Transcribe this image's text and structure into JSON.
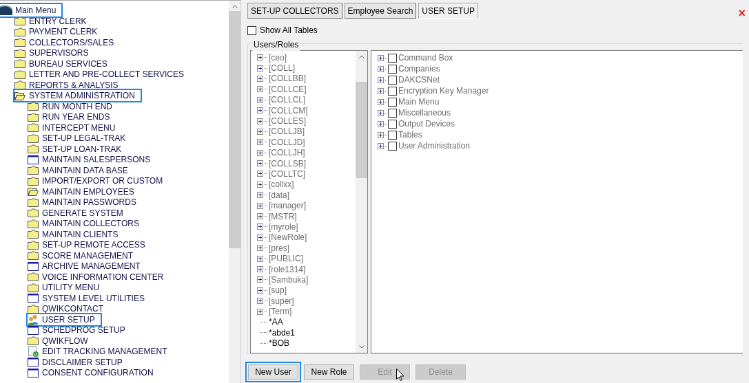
{
  "menu": {
    "label": "Main Menu",
    "highlighted": true,
    "children": [
      {
        "label": "ENTRY CLERK",
        "kind": "folder",
        "highlighted": false
      },
      {
        "label": "PAYMENT CLERK",
        "kind": "folder",
        "highlighted": false
      },
      {
        "label": "COLLECTORS/SALES",
        "kind": "folder",
        "highlighted": false
      },
      {
        "label": "SUPERVISORS",
        "kind": "folder",
        "highlighted": false
      },
      {
        "label": "BUREAU SERVICES",
        "kind": "folder",
        "highlighted": false
      },
      {
        "label": "LETTER AND PRE-COLLECT SERVICES",
        "kind": "folder",
        "highlighted": false
      },
      {
        "label": "REPORTS & ANALYSIS",
        "kind": "folder",
        "highlighted": false
      },
      {
        "label": "SYSTEM ADMINISTRATION",
        "kind": "folder-open",
        "highlighted": true,
        "children": [
          {
            "label": "RUN MONTH END",
            "kind": "folder",
            "highlighted": false
          },
          {
            "label": "RUN YEAR ENDS",
            "kind": "folder",
            "highlighted": false
          },
          {
            "label": "INTERCEPT MENU",
            "kind": "folder",
            "highlighted": false
          },
          {
            "label": "SET-UP LEGAL-TRAK",
            "kind": "folder",
            "highlighted": false
          },
          {
            "label": "SET-UP LOAN-TRAK",
            "kind": "folder",
            "highlighted": false
          },
          {
            "label": "MAINTAIN SALESPERSONS",
            "kind": "window",
            "highlighted": false
          },
          {
            "label": "MAINTAIN DATA BASE",
            "kind": "folder",
            "highlighted": false
          },
          {
            "label": "IMPORT/EXPORT OR CUSTOM",
            "kind": "folder",
            "highlighted": false
          },
          {
            "label": "MAINTAIN EMPLOYEES",
            "kind": "folder-open",
            "highlighted": false
          },
          {
            "label": "MAINTAIN PASSWORDS",
            "kind": "folder",
            "highlighted": false
          },
          {
            "label": "GENERATE SYSTEM",
            "kind": "folder",
            "highlighted": false
          },
          {
            "label": "MAINTAIN COLLECTORS",
            "kind": "folder",
            "highlighted": false
          },
          {
            "label": "MAINTAIN CLIENTS",
            "kind": "folder",
            "highlighted": false
          },
          {
            "label": "SET-UP REMOTE ACCESS",
            "kind": "folder",
            "highlighted": false
          },
          {
            "label": "SCORE MANAGEMENT",
            "kind": "folder",
            "highlighted": false
          },
          {
            "label": "ARCHIVE MANAGEMENT",
            "kind": "window",
            "highlighted": false
          },
          {
            "label": "VOICE INFORMATION CENTER",
            "kind": "folder",
            "highlighted": false
          },
          {
            "label": "UTILITY MENU",
            "kind": "folder",
            "highlighted": false
          },
          {
            "label": "SYSTEM LEVEL UTILITIES",
            "kind": "window",
            "highlighted": false
          },
          {
            "label": "QWIKCONTACT",
            "kind": "folder",
            "highlighted": false
          },
          {
            "label": "USER SETUP",
            "kind": "users",
            "highlighted": true
          },
          {
            "label": "SCHEDPROG SETUP",
            "kind": "window",
            "highlighted": false
          },
          {
            "label": "QWIKFLOW",
            "kind": "folder",
            "highlighted": false
          },
          {
            "label": "EDIT TRACKING MANAGEMENT",
            "kind": "doc-check",
            "highlighted": false
          },
          {
            "label": "DISCLAIMER SETUP",
            "kind": "window",
            "highlighted": false
          },
          {
            "label": "CONSENT CONFIGURATION",
            "kind": "window",
            "highlighted": false
          }
        ]
      }
    ]
  },
  "tabs": [
    {
      "label": "SET-UP COLLECTORS",
      "selected": false
    },
    {
      "label": "Employee Search",
      "selected": false
    },
    {
      "label": "USER SETUP",
      "selected": true
    }
  ],
  "close": "×",
  "show_all_tables": {
    "label": "Show All Tables",
    "checked": false
  },
  "group_title": "Users/Roles",
  "users_roles": [
    {
      "label": "[ceo]",
      "kind": "role"
    },
    {
      "label": "[COLL]",
      "kind": "role"
    },
    {
      "label": "[COLLBB]",
      "kind": "role"
    },
    {
      "label": "[COLLCE]",
      "kind": "role"
    },
    {
      "label": "[COLLCL]",
      "kind": "role"
    },
    {
      "label": "[COLLCM]",
      "kind": "role"
    },
    {
      "label": "[COLLES]",
      "kind": "role"
    },
    {
      "label": "[COLLJB]",
      "kind": "role"
    },
    {
      "label": "[COLLJD]",
      "kind": "role"
    },
    {
      "label": "[COLLJH]",
      "kind": "role"
    },
    {
      "label": "[COLLSB]",
      "kind": "role"
    },
    {
      "label": "[COLLTC]",
      "kind": "role"
    },
    {
      "label": "[collxx]",
      "kind": "role"
    },
    {
      "label": "[data]",
      "kind": "role"
    },
    {
      "label": "[manager]",
      "kind": "role"
    },
    {
      "label": "[MSTR]",
      "kind": "role"
    },
    {
      "label": "[myrole]",
      "kind": "role"
    },
    {
      "label": "[NewRole]",
      "kind": "role"
    },
    {
      "label": "[pres]",
      "kind": "role"
    },
    {
      "label": "[PUBLIC]",
      "kind": "role"
    },
    {
      "label": "[role1314]",
      "kind": "role"
    },
    {
      "label": "[Sambuka]",
      "kind": "role"
    },
    {
      "label": "[sup]",
      "kind": "role"
    },
    {
      "label": "[super]",
      "kind": "role"
    },
    {
      "label": "[Term]",
      "kind": "role"
    },
    {
      "label": "*AA",
      "kind": "user"
    },
    {
      "label": "*abde1",
      "kind": "user"
    },
    {
      "label": "*BOB",
      "kind": "user"
    }
  ],
  "permissions": [
    {
      "label": "Command Box",
      "checked": false
    },
    {
      "label": "Companies",
      "checked": false
    },
    {
      "label": "DAKCSNet",
      "checked": false
    },
    {
      "label": "Encryption Key Manager",
      "checked": false
    },
    {
      "label": "Main Menu",
      "checked": false
    },
    {
      "label": "Miscellaneous",
      "checked": false
    },
    {
      "label": "Output Devices",
      "checked": false
    },
    {
      "label": "Tables",
      "checked": false
    },
    {
      "label": "User Administration",
      "checked": false
    }
  ],
  "buttons": [
    {
      "label": "New User",
      "disabled": false,
      "highlighted": true
    },
    {
      "label": "New Role",
      "disabled": false,
      "highlighted": false
    },
    {
      "label": "Edit",
      "disabled": true,
      "highlighted": false
    },
    {
      "label": "Delete",
      "disabled": true,
      "highlighted": false
    }
  ]
}
